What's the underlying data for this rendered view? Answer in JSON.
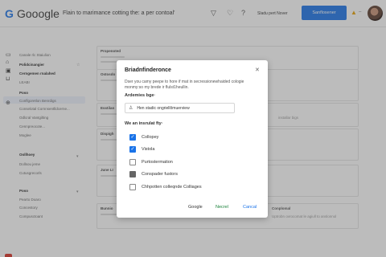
{
  "header": {
    "logo_g": "G",
    "logo_text": "Gooogle",
    "tagline": "Flain to marimance cotting the: a per contoal'",
    "link": "Sladu pert Nover",
    "button": "Sanflosener",
    "icons": [
      "filter-icon",
      "heart-icon",
      "help-icon",
      "warning-icon",
      "avatar"
    ]
  },
  "sidebar": {
    "items": [
      {
        "label": "Canale rlc Staiulion",
        "bold": false
      },
      {
        "label": "Polidcinangier",
        "bold": true
      },
      {
        "label": "Cerngemen rnalahed",
        "bold": true
      },
      {
        "label": "LEABI",
        "bold": false
      },
      {
        "label": "Poso",
        "bold": true
      },
      {
        "label": "Conflgoretlon Benrdigs",
        "bold": false
      },
      {
        "label": "Conselotal Cornnsentlldcerne...",
        "bold": false
      },
      {
        "label": "Odlcral Vantgilting",
        "bold": false
      },
      {
        "label": "Cennpreocote...",
        "bold": false
      },
      {
        "label": "Moglee",
        "bold": false
      },
      {
        "label": "Oollhoey",
        "bold": true
      },
      {
        "label": "Dollsou jeme",
        "bold": false
      },
      {
        "label": "Cutusgrecorls",
        "bold": false
      },
      {
        "label": "Poso",
        "bold": true
      },
      {
        "label": "Pearto Doaro",
        "bold": false
      },
      {
        "label": "Concestory",
        "bold": false
      },
      {
        "label": "Compusctoant",
        "bold": false
      }
    ]
  },
  "background": {
    "cards": [
      "Propenoted",
      "Ostosdo",
      "Esstilan",
      "Dispigh",
      "June LI",
      "Bunnio"
    ],
    "right_texts": [
      "installar bigs",
      "Conplomal",
      "Uptrobn ovrocomat le agiull to anslonnol"
    ]
  },
  "dialog": {
    "title": "Briadnfinderonce",
    "description": "Dser you camy peepe to hore if mat in secressionewhaided cologie monmy:so my brede ir flulst1heullin.",
    "label1": "Ardemies bge·",
    "input_value": "Hen stadic ongriellômuerview",
    "label2": "We an insrulat fty·",
    "options": [
      {
        "label": "Collopey",
        "state": "checked"
      },
      {
        "label": "Vistola",
        "state": "checked"
      },
      {
        "label": "Purtostermation",
        "state": "unchecked"
      },
      {
        "label": "Conspader fustors",
        "state": "filled"
      },
      {
        "label": "Chhpotten colleqnde Colliages",
        "state": "unchecked"
      }
    ],
    "actions": {
      "google": "Google",
      "neutral": "Necrel",
      "cancel": "Cancal"
    }
  }
}
